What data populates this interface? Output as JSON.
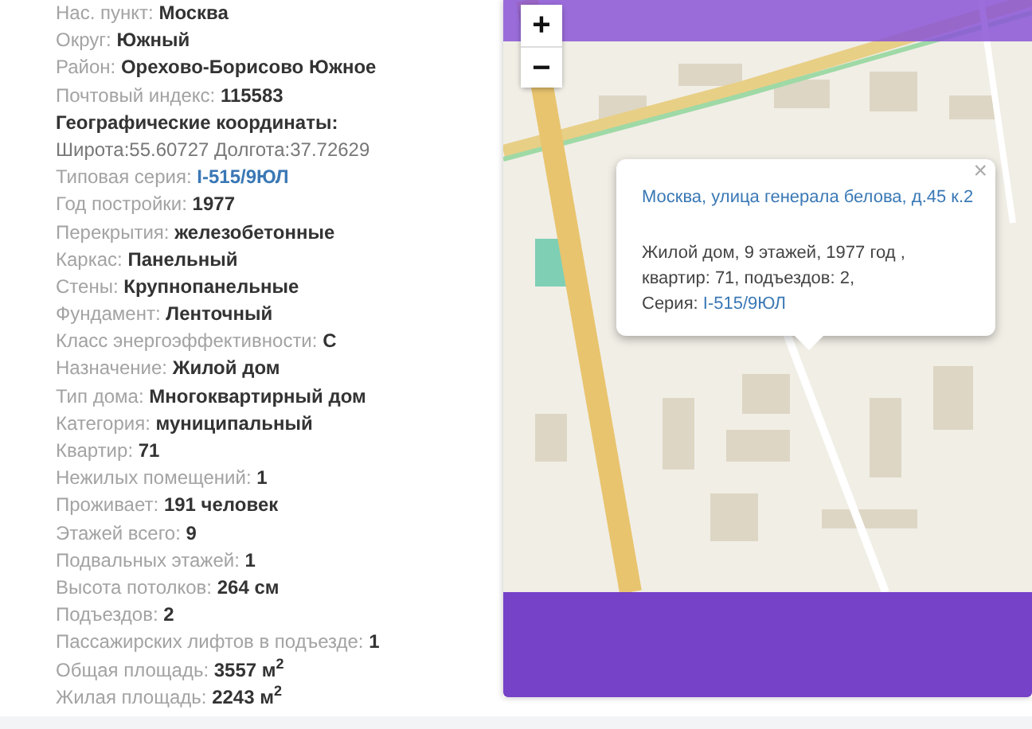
{
  "details": [
    {
      "kind": "field",
      "label": "Нас. пункт:",
      "value": "Москва"
    },
    {
      "kind": "field",
      "label": "Округ:",
      "value": "Южный"
    },
    {
      "kind": "field",
      "label": "Район:",
      "value": "Орехово-Борисово Южное"
    },
    {
      "kind": "field",
      "label": "Почтовый индекс:",
      "value": "115583"
    },
    {
      "kind": "heading",
      "text": "Географические координаты:"
    },
    {
      "kind": "text",
      "text": "Широта:55.60727 Долгота:37.72629"
    },
    {
      "kind": "link",
      "label": "Типовая серия:",
      "value": "I-515/9ЮЛ"
    },
    {
      "kind": "field",
      "label": "Год постройки:",
      "value": "1977"
    },
    {
      "kind": "field",
      "label": "Перекрытия:",
      "value": "железобетонные"
    },
    {
      "kind": "field",
      "label": "Каркас:",
      "value": "Панельный"
    },
    {
      "kind": "field",
      "label": "Стены:",
      "value": "Крупнопанельные"
    },
    {
      "kind": "field",
      "label": "Фундамент:",
      "value": "Ленточный"
    },
    {
      "kind": "field",
      "label": "Класс энергоэффективности:",
      "value": "C"
    },
    {
      "kind": "field",
      "label": "Назначение:",
      "value": "Жилой дом"
    },
    {
      "kind": "field",
      "label": "Тип дома:",
      "value": "Многоквартирный дом"
    },
    {
      "kind": "field",
      "label": "Категория:",
      "value": "муниципальный"
    },
    {
      "kind": "field",
      "label": "Квартир:",
      "value": "71"
    },
    {
      "kind": "field",
      "label": "Нежилых помещений:",
      "value": "1"
    },
    {
      "kind": "field",
      "label": "Проживает:",
      "value": "191 человек"
    },
    {
      "kind": "field",
      "label": "Этажей всего:",
      "value": "9"
    },
    {
      "kind": "field",
      "label": "Подвальных этажей:",
      "value": "1"
    },
    {
      "kind": "field",
      "label": "Высота потолков:",
      "value": "264 см"
    },
    {
      "kind": "field",
      "label": "Подъездов:",
      "value": "2"
    },
    {
      "kind": "field",
      "label": "Пассажирских лифтов в подъезде:",
      "value": "1"
    },
    {
      "kind": "field",
      "label": "Общая площадь:",
      "value": "3557 м$^{2}$"
    },
    {
      "kind": "field",
      "label": "Жилая площадь:",
      "value": "2243 м$^{2}$"
    }
  ],
  "map": {
    "zoom_buttons": [
      "+",
      "−"
    ],
    "popup": {
      "title": "Москва, улица генерала белова, д.45 к.2",
      "lines": [
        "Жилой дом, 9 этажей, 1977 год ,",
        "квартир: 71, подъездов: 2,"
      ],
      "series_label": "Серия:",
      "series_link": "I-515/9ЮЛ",
      "close": "×"
    }
  }
}
